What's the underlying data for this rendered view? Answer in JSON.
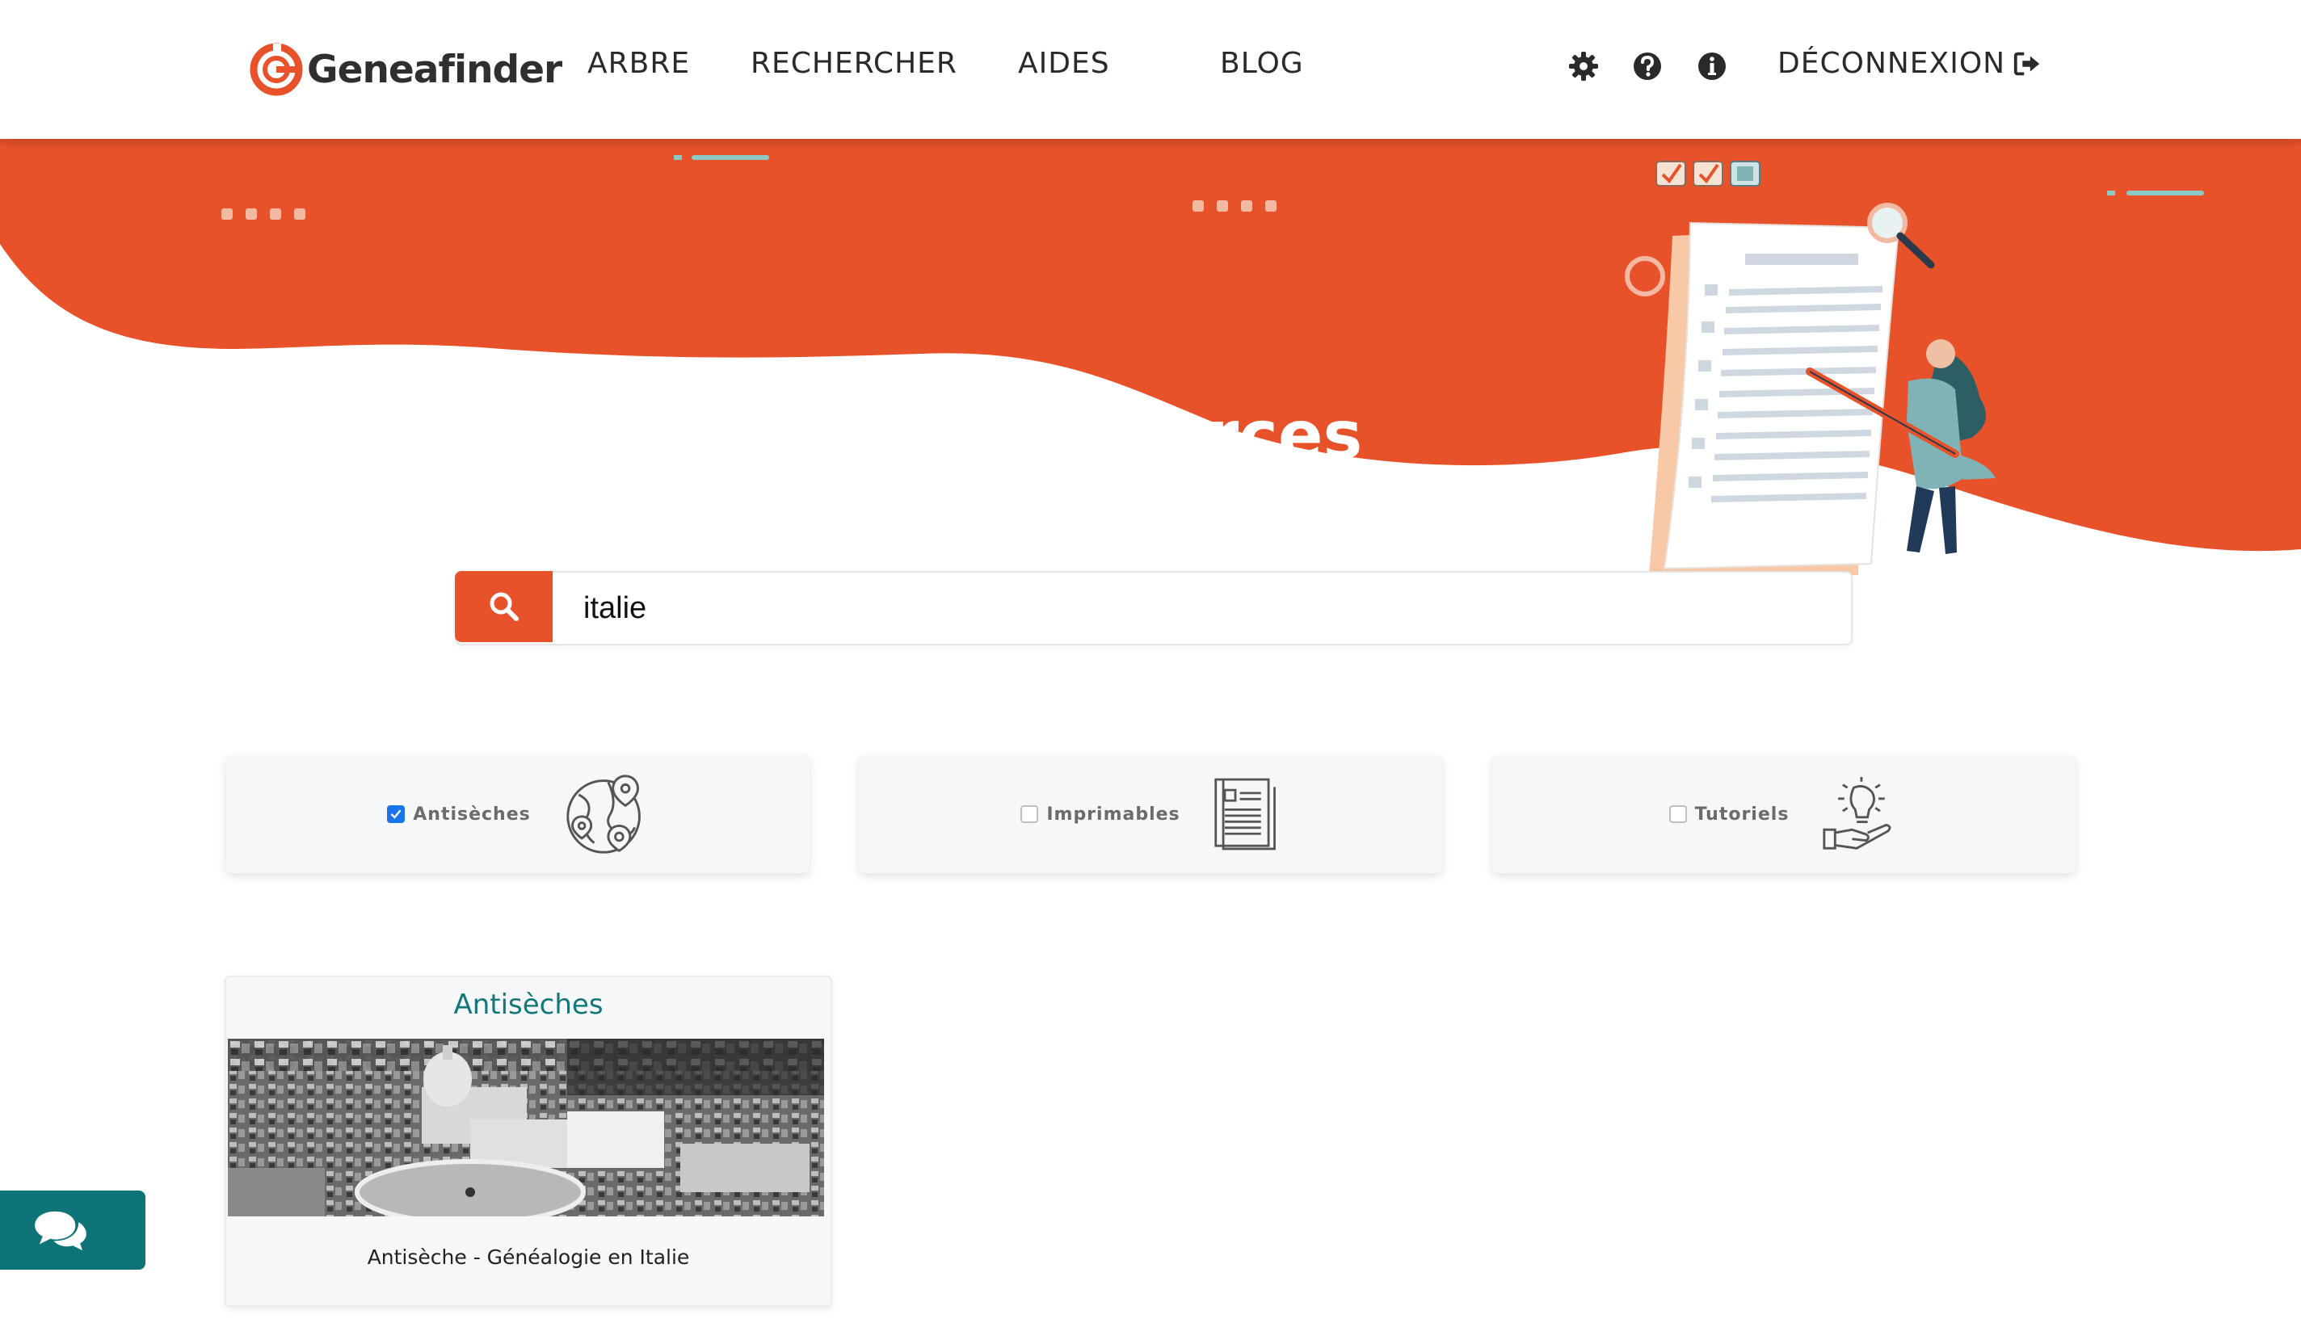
{
  "brand": {
    "name": "Geneafinder",
    "accent": "#e8522a",
    "teal": "#12777a"
  },
  "nav": {
    "links": [
      "ARBRE",
      "RECHERCHER",
      "AIDES",
      "BLOG"
    ],
    "icons": [
      "gear-icon",
      "question-circle-icon",
      "info-circle-icon"
    ],
    "logout_label": "DÉCONNEXION"
  },
  "hero": {
    "title": "Ressources"
  },
  "search": {
    "value": "italie"
  },
  "filters": [
    {
      "label": "Antisèches",
      "checked": true,
      "icon": "globe-map-icon"
    },
    {
      "label": "Imprimables",
      "checked": false,
      "icon": "document-icon"
    },
    {
      "label": "Tutoriels",
      "checked": false,
      "icon": "lightbulb-hand-icon"
    }
  ],
  "results": [
    {
      "category": "Antisèches",
      "title": "Antisèche - Généalogie en Italie"
    }
  ],
  "chat": {
    "icon": "chat-bubbles-icon"
  }
}
